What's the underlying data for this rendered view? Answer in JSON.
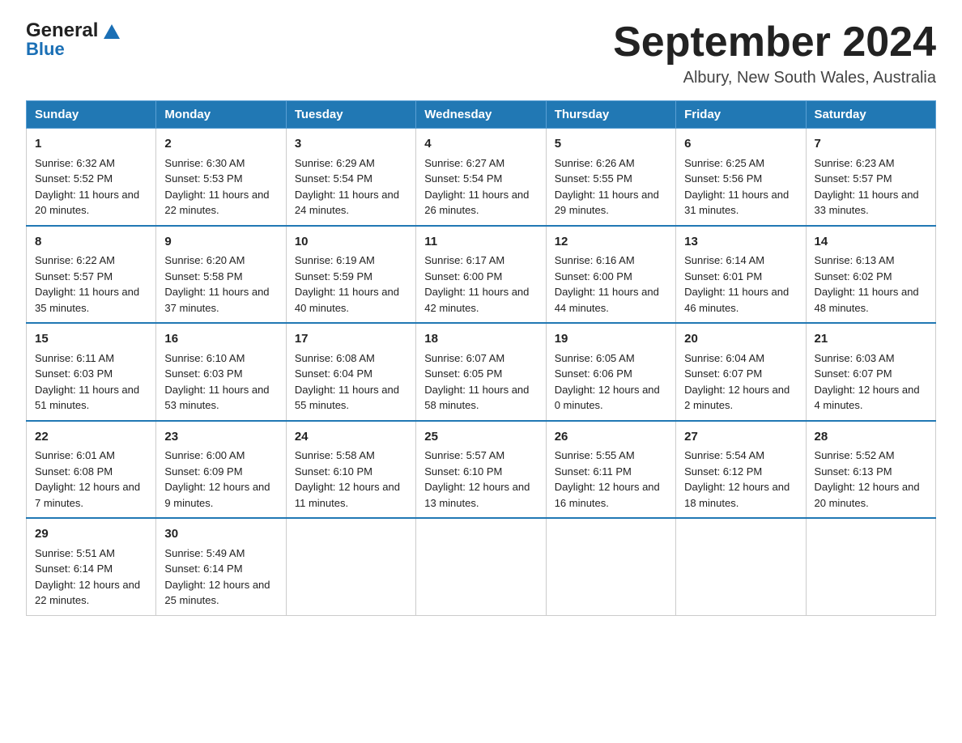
{
  "logo": {
    "general": "General",
    "blue": "Blue",
    "alt": "GeneralBlue logo"
  },
  "header": {
    "month_year": "September 2024",
    "location": "Albury, New South Wales, Australia"
  },
  "weekdays": [
    "Sunday",
    "Monday",
    "Tuesday",
    "Wednesday",
    "Thursday",
    "Friday",
    "Saturday"
  ],
  "weeks": [
    [
      {
        "day": "1",
        "sunrise": "Sunrise: 6:32 AM",
        "sunset": "Sunset: 5:52 PM",
        "daylight": "Daylight: 11 hours and 20 minutes."
      },
      {
        "day": "2",
        "sunrise": "Sunrise: 6:30 AM",
        "sunset": "Sunset: 5:53 PM",
        "daylight": "Daylight: 11 hours and 22 minutes."
      },
      {
        "day": "3",
        "sunrise": "Sunrise: 6:29 AM",
        "sunset": "Sunset: 5:54 PM",
        "daylight": "Daylight: 11 hours and 24 minutes."
      },
      {
        "day": "4",
        "sunrise": "Sunrise: 6:27 AM",
        "sunset": "Sunset: 5:54 PM",
        "daylight": "Daylight: 11 hours and 26 minutes."
      },
      {
        "day": "5",
        "sunrise": "Sunrise: 6:26 AM",
        "sunset": "Sunset: 5:55 PM",
        "daylight": "Daylight: 11 hours and 29 minutes."
      },
      {
        "day": "6",
        "sunrise": "Sunrise: 6:25 AM",
        "sunset": "Sunset: 5:56 PM",
        "daylight": "Daylight: 11 hours and 31 minutes."
      },
      {
        "day": "7",
        "sunrise": "Sunrise: 6:23 AM",
        "sunset": "Sunset: 5:57 PM",
        "daylight": "Daylight: 11 hours and 33 minutes."
      }
    ],
    [
      {
        "day": "8",
        "sunrise": "Sunrise: 6:22 AM",
        "sunset": "Sunset: 5:57 PM",
        "daylight": "Daylight: 11 hours and 35 minutes."
      },
      {
        "day": "9",
        "sunrise": "Sunrise: 6:20 AM",
        "sunset": "Sunset: 5:58 PM",
        "daylight": "Daylight: 11 hours and 37 minutes."
      },
      {
        "day": "10",
        "sunrise": "Sunrise: 6:19 AM",
        "sunset": "Sunset: 5:59 PM",
        "daylight": "Daylight: 11 hours and 40 minutes."
      },
      {
        "day": "11",
        "sunrise": "Sunrise: 6:17 AM",
        "sunset": "Sunset: 6:00 PM",
        "daylight": "Daylight: 11 hours and 42 minutes."
      },
      {
        "day": "12",
        "sunrise": "Sunrise: 6:16 AM",
        "sunset": "Sunset: 6:00 PM",
        "daylight": "Daylight: 11 hours and 44 minutes."
      },
      {
        "day": "13",
        "sunrise": "Sunrise: 6:14 AM",
        "sunset": "Sunset: 6:01 PM",
        "daylight": "Daylight: 11 hours and 46 minutes."
      },
      {
        "day": "14",
        "sunrise": "Sunrise: 6:13 AM",
        "sunset": "Sunset: 6:02 PM",
        "daylight": "Daylight: 11 hours and 48 minutes."
      }
    ],
    [
      {
        "day": "15",
        "sunrise": "Sunrise: 6:11 AM",
        "sunset": "Sunset: 6:03 PM",
        "daylight": "Daylight: 11 hours and 51 minutes."
      },
      {
        "day": "16",
        "sunrise": "Sunrise: 6:10 AM",
        "sunset": "Sunset: 6:03 PM",
        "daylight": "Daylight: 11 hours and 53 minutes."
      },
      {
        "day": "17",
        "sunrise": "Sunrise: 6:08 AM",
        "sunset": "Sunset: 6:04 PM",
        "daylight": "Daylight: 11 hours and 55 minutes."
      },
      {
        "day": "18",
        "sunrise": "Sunrise: 6:07 AM",
        "sunset": "Sunset: 6:05 PM",
        "daylight": "Daylight: 11 hours and 58 minutes."
      },
      {
        "day": "19",
        "sunrise": "Sunrise: 6:05 AM",
        "sunset": "Sunset: 6:06 PM",
        "daylight": "Daylight: 12 hours and 0 minutes."
      },
      {
        "day": "20",
        "sunrise": "Sunrise: 6:04 AM",
        "sunset": "Sunset: 6:07 PM",
        "daylight": "Daylight: 12 hours and 2 minutes."
      },
      {
        "day": "21",
        "sunrise": "Sunrise: 6:03 AM",
        "sunset": "Sunset: 6:07 PM",
        "daylight": "Daylight: 12 hours and 4 minutes."
      }
    ],
    [
      {
        "day": "22",
        "sunrise": "Sunrise: 6:01 AM",
        "sunset": "Sunset: 6:08 PM",
        "daylight": "Daylight: 12 hours and 7 minutes."
      },
      {
        "day": "23",
        "sunrise": "Sunrise: 6:00 AM",
        "sunset": "Sunset: 6:09 PM",
        "daylight": "Daylight: 12 hours and 9 minutes."
      },
      {
        "day": "24",
        "sunrise": "Sunrise: 5:58 AM",
        "sunset": "Sunset: 6:10 PM",
        "daylight": "Daylight: 12 hours and 11 minutes."
      },
      {
        "day": "25",
        "sunrise": "Sunrise: 5:57 AM",
        "sunset": "Sunset: 6:10 PM",
        "daylight": "Daylight: 12 hours and 13 minutes."
      },
      {
        "day": "26",
        "sunrise": "Sunrise: 5:55 AM",
        "sunset": "Sunset: 6:11 PM",
        "daylight": "Daylight: 12 hours and 16 minutes."
      },
      {
        "day": "27",
        "sunrise": "Sunrise: 5:54 AM",
        "sunset": "Sunset: 6:12 PM",
        "daylight": "Daylight: 12 hours and 18 minutes."
      },
      {
        "day": "28",
        "sunrise": "Sunrise: 5:52 AM",
        "sunset": "Sunset: 6:13 PM",
        "daylight": "Daylight: 12 hours and 20 minutes."
      }
    ],
    [
      {
        "day": "29",
        "sunrise": "Sunrise: 5:51 AM",
        "sunset": "Sunset: 6:14 PM",
        "daylight": "Daylight: 12 hours and 22 minutes."
      },
      {
        "day": "30",
        "sunrise": "Sunrise: 5:49 AM",
        "sunset": "Sunset: 6:14 PM",
        "daylight": "Daylight: 12 hours and 25 minutes."
      },
      null,
      null,
      null,
      null,
      null
    ]
  ]
}
